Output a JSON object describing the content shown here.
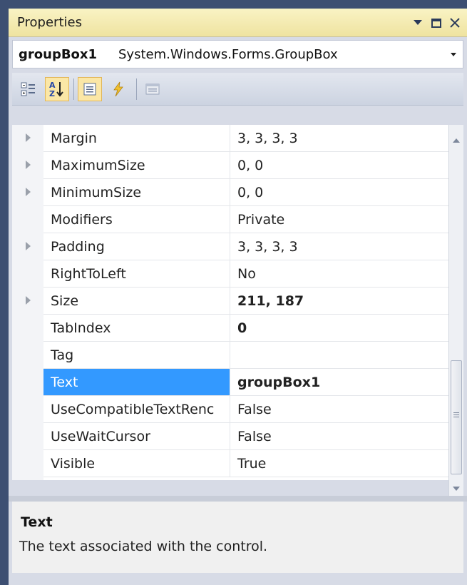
{
  "window": {
    "title": "Properties",
    "controls": [
      "pin-icon",
      "maximize-icon",
      "close-icon"
    ]
  },
  "selector": {
    "object_name": "groupBox1",
    "object_type": "System.Windows.Forms.GroupBox"
  },
  "toolbar": {
    "buttons": [
      "categorized-icon",
      "alphabetical-icon",
      "properties-icon",
      "events-icon",
      "property-pages-icon"
    ],
    "active": "alphabetical-icon"
  },
  "properties": [
    {
      "name": "Margin",
      "value": "3, 3, 3, 3",
      "expandable": true,
      "bold": false
    },
    {
      "name": "MaximumSize",
      "value": "0, 0",
      "expandable": true,
      "bold": false
    },
    {
      "name": "MinimumSize",
      "value": "0, 0",
      "expandable": true,
      "bold": false
    },
    {
      "name": "Modifiers",
      "value": "Private",
      "expandable": false,
      "bold": false
    },
    {
      "name": "Padding",
      "value": "3, 3, 3, 3",
      "expandable": true,
      "bold": false
    },
    {
      "name": "RightToLeft",
      "value": "No",
      "expandable": false,
      "bold": false
    },
    {
      "name": "Size",
      "value": "211, 187",
      "expandable": true,
      "bold": true
    },
    {
      "name": "TabIndex",
      "value": "0",
      "expandable": false,
      "bold": true
    },
    {
      "name": "Tag",
      "value": "",
      "expandable": false,
      "bold": false
    },
    {
      "name": "Text",
      "value": "groupBox1",
      "expandable": false,
      "bold": true,
      "selected": true
    },
    {
      "name": "UseCompatibleTextRenc",
      "value": "False",
      "expandable": false,
      "bold": false
    },
    {
      "name": "UseWaitCursor",
      "value": "False",
      "expandable": false,
      "bold": false
    },
    {
      "name": "Visible",
      "value": "True",
      "expandable": false,
      "bold": false
    }
  ],
  "description": {
    "title": "Text",
    "text": "The text associated with the control."
  },
  "colors": {
    "selection": "#3399ff",
    "titlebar": "#f4eab0",
    "frame": "#3d4f72"
  }
}
